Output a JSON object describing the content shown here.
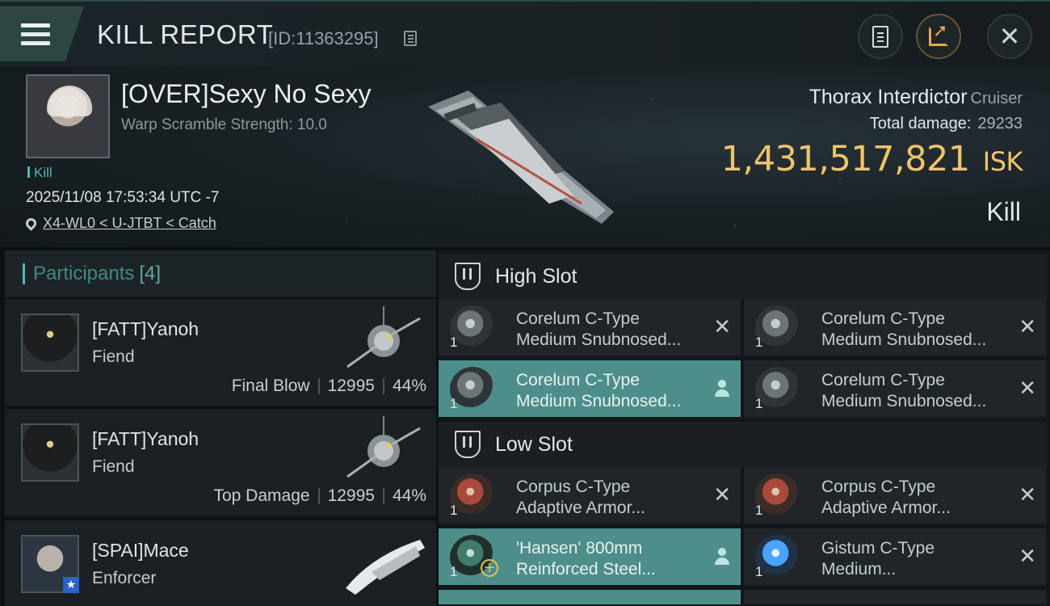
{
  "header": {
    "title": "KILL REPORT",
    "kill_id": "[ID:11363295]",
    "icons": [
      "menu-icon",
      "copy-icon",
      "clipboard-icon",
      "share-icon",
      "close-icon"
    ],
    "close_glyph": "✕"
  },
  "victim": {
    "name": "[OVER]Sexy No Sexy",
    "warp_scramble": "Warp Scramble Strength: 10.0",
    "kill_tag": "Kill",
    "timestamp": "2025/11/08 17:53:34 UTC -7",
    "location": "X4-WL0 < U-JTBT < Catch",
    "ship_name": "Thorax Interdictor",
    "ship_class": "Cruiser",
    "total_damage_label": "Total damage:",
    "total_damage": "29233",
    "isk_value": "1,431,517,821",
    "isk_unit": "ISK",
    "result": "Kill"
  },
  "participants": {
    "label": "Participants",
    "count": "[4]",
    "items": [
      {
        "name": "[FATT]Yanoh",
        "ship": "Fiend",
        "role": "Final Blow",
        "damage": "12995",
        "percent": "44%"
      },
      {
        "name": "[FATT]Yanoh",
        "ship": "Fiend",
        "role": "Top Damage",
        "damage": "12995",
        "percent": "44%"
      },
      {
        "name": "[SPAI]Mace",
        "ship": "Enforcer",
        "badge": "★"
      }
    ]
  },
  "slots": {
    "high": {
      "label": "High Slot",
      "items": [
        {
          "name_line1": "Corelum C-Type",
          "name_line2": "Medium Snubnosed...",
          "qty": "1",
          "status": "destroyed",
          "highlighted": false
        },
        {
          "name_line1": "Corelum C-Type",
          "name_line2": "Medium Snubnosed...",
          "qty": "1",
          "status": "destroyed",
          "highlighted": false
        },
        {
          "name_line1": "Corelum C-Type",
          "name_line2": "Medium Snubnosed...",
          "qty": "1",
          "status": "dropped",
          "highlighted": true
        },
        {
          "name_line1": "Corelum C-Type",
          "name_line2": "Medium Snubnosed...",
          "qty": "1",
          "status": "destroyed",
          "highlighted": false
        }
      ]
    },
    "low": {
      "label": "Low Slot",
      "items": [
        {
          "name_line1": "Corpus C-Type",
          "name_line2": "Adaptive Armor...",
          "qty": "1",
          "status": "destroyed",
          "highlighted": false
        },
        {
          "name_line1": "Corpus C-Type",
          "name_line2": "Adaptive Armor...",
          "qty": "1",
          "status": "destroyed",
          "highlighted": false
        },
        {
          "name_line1": "'Hansen' 800mm",
          "name_line2": "Reinforced Steel...",
          "qty": "1",
          "status": "dropped",
          "highlighted": true
        },
        {
          "name_line1": "Gistum C-Type",
          "name_line2": "Medium...",
          "qty": "1",
          "status": "destroyed",
          "highlighted": false
        }
      ]
    },
    "status_glyph_destroyed": "✕"
  },
  "colors": {
    "accent_teal": "#4fb8ae",
    "isk_gold": "#f1c46a",
    "highlight_row": "#4d8e8a"
  }
}
